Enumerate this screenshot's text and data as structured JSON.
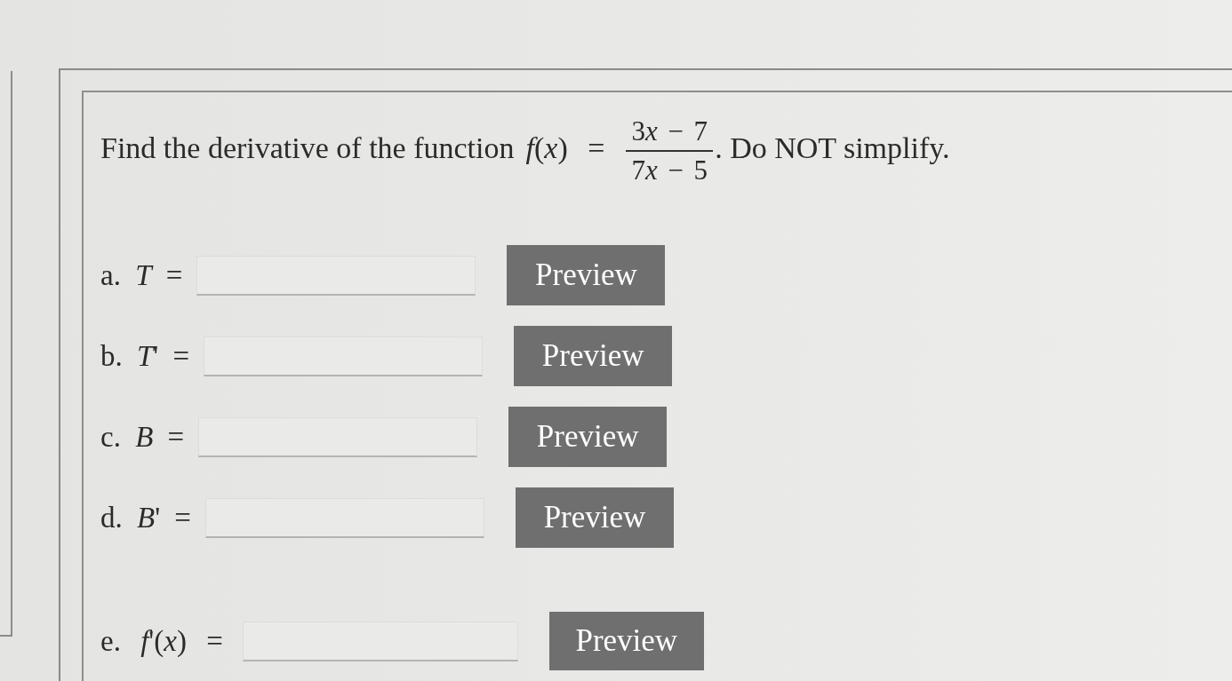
{
  "question": {
    "text_before": "Find the derivative of the function",
    "lhs": "*f*(*x*) =",
    "numerator": {
      "coefficient": "3",
      "variable": "x",
      "constant": "− 7"
    },
    "denominator": {
      "coefficient": "7",
      "variable": "x",
      "constant": "− 5"
    },
    "text_after": ". Do NOT simplify."
  },
  "parts": [
    {
      "label": "a. *T* =",
      "button": "Preview"
    },
    {
      "label": "b. *T*' =",
      "button": "Preview"
    },
    {
      "label": "c. *B* =",
      "button": "Preview"
    },
    {
      "label": "d. *B*' =",
      "button": "Preview"
    }
  ],
  "final": {
    "label": "e. *f*'(*x*) =",
    "button": "Preview"
  }
}
